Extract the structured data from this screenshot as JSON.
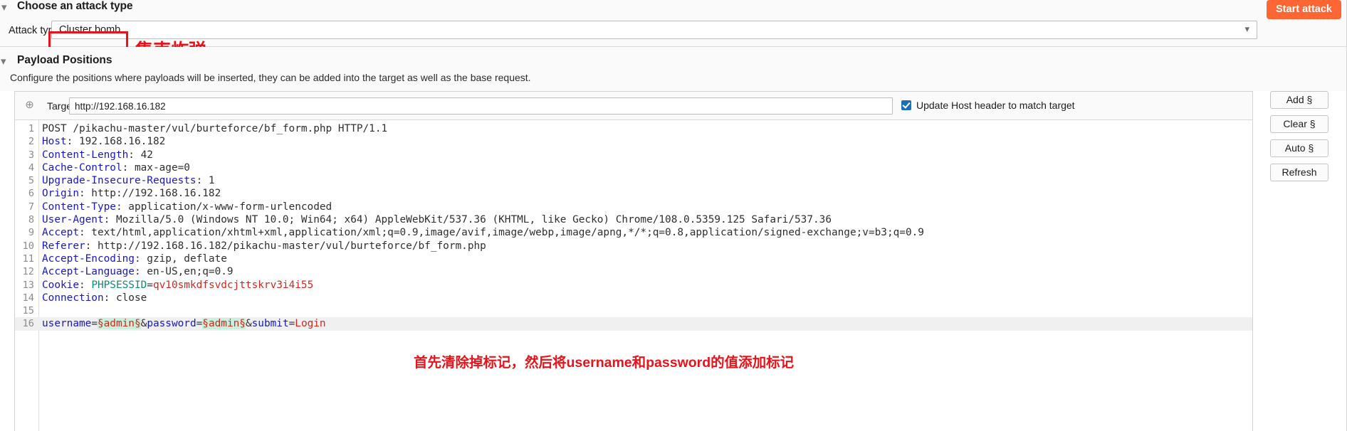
{
  "attack_section": {
    "title": "Choose an attack type",
    "collapse_icon": "chevron-down-icon",
    "attack_type_label": "Attack type:",
    "attack_type_value": "Cluster bomb",
    "attack_type_caret": "chevron-down-icon",
    "annotation_cn": "集束炸弹",
    "annotation_color": "#e8131a",
    "start_attack_label": "Start attack",
    "start_attack_color": "#ff6633"
  },
  "payload_positions": {
    "title": "Payload Positions",
    "collapse_icon": "chevron-down-icon",
    "description": "Configure the positions where payloads will be inserted, they can be added into the target as well as the base request."
  },
  "target": {
    "icon": "crosshair-icon",
    "label": "Target:",
    "value": "http://192.168.16.182",
    "placeholder": "",
    "update_host_label": "Update Host header to match target",
    "update_host_checked": true,
    "checkbox_color": "#1f6fb2"
  },
  "side_buttons": [
    {
      "label": "Add §",
      "name": "add-section-button"
    },
    {
      "label": "Clear §",
      "name": "clear-section-button"
    },
    {
      "label": "Auto §",
      "name": "auto-section-button"
    },
    {
      "label": "Refresh",
      "name": "refresh-button"
    }
  ],
  "request": {
    "annotation_cn": "首先清除掉标记，然后将username和password的值添加标记",
    "lines": [
      {
        "no": "1",
        "segments": [
          {
            "t": "POST /pikachu-master/vul/burteforce/bf_form.php HTTP/1.1",
            "c": "v"
          }
        ]
      },
      {
        "no": "2",
        "segments": [
          {
            "t": "Host",
            "c": "k"
          },
          {
            "t": ": 192.168.16.182",
            "c": "v"
          }
        ]
      },
      {
        "no": "3",
        "segments": [
          {
            "t": "Content-Length",
            "c": "k"
          },
          {
            "t": ": 42",
            "c": "v"
          }
        ]
      },
      {
        "no": "4",
        "segments": [
          {
            "t": "Cache-Control",
            "c": "k"
          },
          {
            "t": ": max-age=0",
            "c": "v"
          }
        ]
      },
      {
        "no": "5",
        "segments": [
          {
            "t": "Upgrade-Insecure-Requests",
            "c": "k"
          },
          {
            "t": ": 1",
            "c": "v"
          }
        ]
      },
      {
        "no": "6",
        "segments": [
          {
            "t": "Origin",
            "c": "k"
          },
          {
            "t": ": http://192.168.16.182",
            "c": "v"
          }
        ]
      },
      {
        "no": "7",
        "segments": [
          {
            "t": "Content-Type",
            "c": "k"
          },
          {
            "t": ": application/x-www-form-urlencoded",
            "c": "v"
          }
        ]
      },
      {
        "no": "8",
        "segments": [
          {
            "t": "User-Agent",
            "c": "k"
          },
          {
            "t": ": Mozilla/5.0 (Windows NT 10.0; Win64; x64) AppleWebKit/537.36 (KHTML, like Gecko) Chrome/108.0.5359.125 Safari/537.36",
            "c": "v"
          }
        ]
      },
      {
        "no": "9",
        "segments": [
          {
            "t": "Accept",
            "c": "k"
          },
          {
            "t": ": text/html,application/xhtml+xml,application/xml;q=0.9,image/avif,image/webp,image/apng,*/*;q=0.8,application/signed-exchange;v=b3;q=0.9",
            "c": "v"
          }
        ]
      },
      {
        "no": "10",
        "segments": [
          {
            "t": "Referer",
            "c": "k"
          },
          {
            "t": ": http://192.168.16.182/pikachu-master/vul/burteforce/bf_form.php",
            "c": "v"
          }
        ]
      },
      {
        "no": "11",
        "segments": [
          {
            "t": "Accept-Encoding",
            "c": "k"
          },
          {
            "t": ": gzip, deflate",
            "c": "v"
          }
        ]
      },
      {
        "no": "12",
        "segments": [
          {
            "t": "Accept-Language",
            "c": "k"
          },
          {
            "t": ": en-US,en;q=0.9",
            "c": "v"
          }
        ]
      },
      {
        "no": "13",
        "segments": [
          {
            "t": "Cookie",
            "c": "k"
          },
          {
            "t": ": ",
            "c": "v"
          },
          {
            "t": "PHPSESSID",
            "c": "teal"
          },
          {
            "t": "=",
            "c": "v"
          },
          {
            "t": "qv10smkdfsvdcjttskrv3i4i55",
            "c": "red"
          }
        ]
      },
      {
        "no": "14",
        "segments": [
          {
            "t": "Connection",
            "c": "k"
          },
          {
            "t": ": close",
            "c": "v"
          }
        ]
      },
      {
        "no": "15",
        "segments": [
          {
            "t": "",
            "c": "v"
          }
        ]
      },
      {
        "no": "16",
        "highlight": true,
        "segments": [
          {
            "t": "username",
            "c": "blue2"
          },
          {
            "t": "=",
            "c": "v"
          },
          {
            "t": "§admin§",
            "c": "red",
            "mark": true
          },
          {
            "t": "&",
            "c": "v"
          },
          {
            "t": "password",
            "c": "blue2"
          },
          {
            "t": "=",
            "c": "v"
          },
          {
            "t": "§admin§",
            "c": "red",
            "mark": true
          },
          {
            "t": "&",
            "c": "v"
          },
          {
            "t": "submit",
            "c": "blue2"
          },
          {
            "t": "=",
            "c": "v"
          },
          {
            "t": "Login",
            "c": "red"
          }
        ]
      }
    ]
  }
}
